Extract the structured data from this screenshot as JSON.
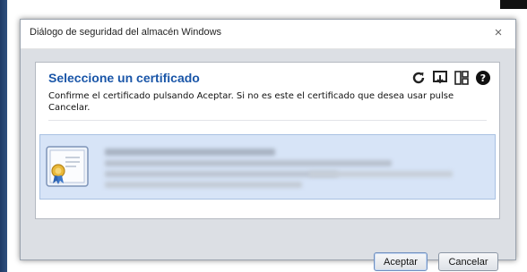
{
  "window": {
    "title": "Diálogo de seguridad del almacén Windows",
    "close_glyph": "×"
  },
  "panel": {
    "heading": "Seleccione un certificado",
    "instructions": "Confirme el certificado pulsando Aceptar. Si no es este el certificado que desea usar pulse Cancelar.",
    "toolbar_icons": [
      "refresh-icon",
      "import-icon",
      "certificate-details-icon",
      "help-icon"
    ]
  },
  "certificate_list": {
    "selected_entry": {
      "icon": "certificate-icon",
      "details_redacted": true
    }
  },
  "buttons": {
    "accept_label": "Aceptar",
    "cancel_label": "Cancelar"
  },
  "colors": {
    "heading": "#1a56a8",
    "selection_bg": "#d7e4f7",
    "dialog_bg": "#dcdfe4"
  }
}
